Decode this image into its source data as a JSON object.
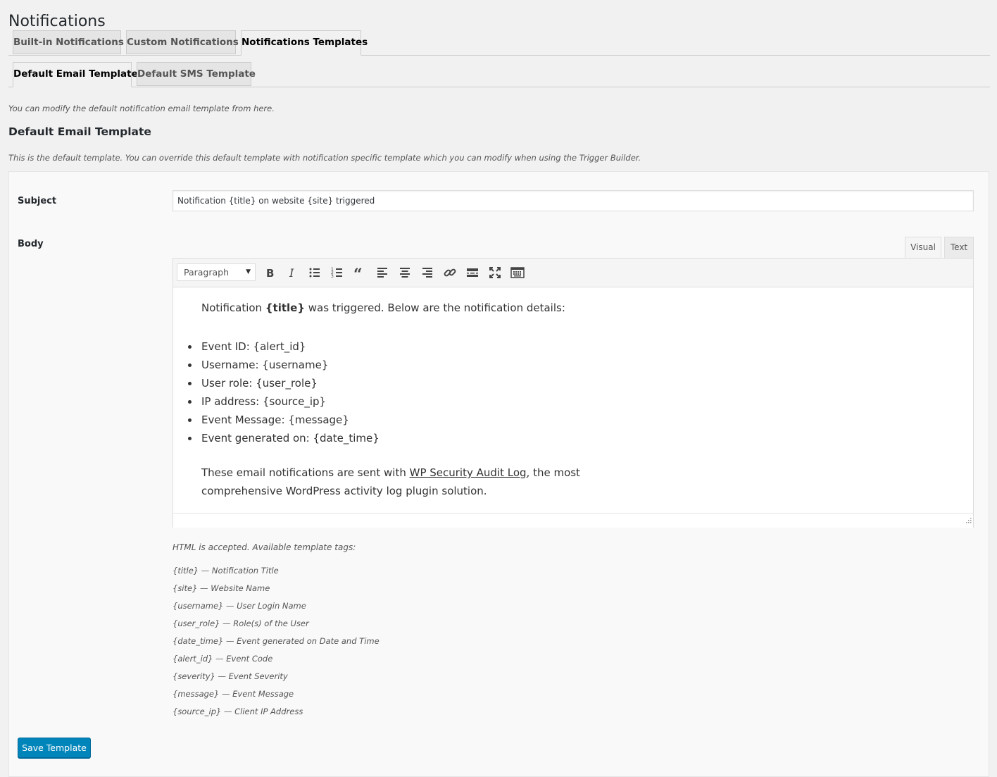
{
  "page_title": "Notifications",
  "main_tabs": [
    {
      "label": "Built-in Notifications",
      "active": false
    },
    {
      "label": "Custom Notifications",
      "active": false
    },
    {
      "label": "Notifications Templates",
      "active": true
    }
  ],
  "sub_tabs": [
    {
      "label": "Default Email Template",
      "active": true
    },
    {
      "label": "Default SMS Template",
      "active": false
    }
  ],
  "intro_text": "You can modify the default notification email template from here.",
  "section_title": "Default Email Template",
  "section_description": "This is the default template. You can override this default template with notification specific template which you can modify when using the Trigger Builder.",
  "form": {
    "subject_label": "Subject",
    "subject_value": "Notification {title} on website {site} triggered",
    "body_label": "Body"
  },
  "editor": {
    "mode_tabs": {
      "visual": "Visual",
      "text": "Text",
      "active": "visual"
    },
    "format_select": "Paragraph",
    "toolbar_icons": [
      "bold-icon",
      "italic-icon",
      "bulleted-list-icon",
      "numbered-list-icon",
      "blockquote-icon",
      "align-left-icon",
      "align-center-icon",
      "align-right-icon",
      "link-icon",
      "read-more-icon",
      "fullscreen-icon",
      "toolbar-toggle-icon"
    ],
    "intro_before": "Notification ",
    "intro_bold": "{title}",
    "intro_after": " was triggered. Below are the notification details:",
    "items": [
      "Event ID: {alert_id}",
      "Username: {username}",
      "User role: {user_role}",
      "IP address: {source_ip}",
      "Event Message: {message}",
      "Event generated on: {date_time}"
    ],
    "footer_before": "These email notifications are sent with ",
    "footer_link": "WP Security Audit Log",
    "footer_after_line1": ", the most",
    "footer_line2": "comprehensive WordPress activity log plugin solution."
  },
  "tags_heading": "HTML is accepted. Available template tags:",
  "template_tags": [
    "{title} — Notification Title",
    "{site} — Website Name",
    "{username} — User Login Name",
    "{user_role} — Role(s) of the User",
    "{date_time} — Event generated on Date and Time",
    "{alert_id} — Event Code",
    "{severity} — Event Severity",
    "{message} — Event Message",
    "{source_ip} — Client IP Address"
  ],
  "save_button": "Save Template",
  "colors": {
    "primary_button": "#0085ba",
    "background": "#f1f1f1",
    "panel": "#f9f9f9"
  }
}
